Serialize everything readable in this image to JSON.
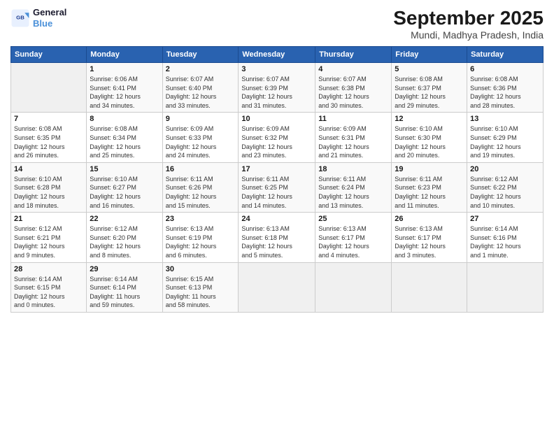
{
  "logo": {
    "line1": "General",
    "line2": "Blue"
  },
  "title": "September 2025",
  "subtitle": "Mundi, Madhya Pradesh, India",
  "days_header": [
    "Sunday",
    "Monday",
    "Tuesday",
    "Wednesday",
    "Thursday",
    "Friday",
    "Saturday"
  ],
  "weeks": [
    [
      {
        "num": "",
        "info": ""
      },
      {
        "num": "1",
        "info": "Sunrise: 6:06 AM\nSunset: 6:41 PM\nDaylight: 12 hours\nand 34 minutes."
      },
      {
        "num": "2",
        "info": "Sunrise: 6:07 AM\nSunset: 6:40 PM\nDaylight: 12 hours\nand 33 minutes."
      },
      {
        "num": "3",
        "info": "Sunrise: 6:07 AM\nSunset: 6:39 PM\nDaylight: 12 hours\nand 31 minutes."
      },
      {
        "num": "4",
        "info": "Sunrise: 6:07 AM\nSunset: 6:38 PM\nDaylight: 12 hours\nand 30 minutes."
      },
      {
        "num": "5",
        "info": "Sunrise: 6:08 AM\nSunset: 6:37 PM\nDaylight: 12 hours\nand 29 minutes."
      },
      {
        "num": "6",
        "info": "Sunrise: 6:08 AM\nSunset: 6:36 PM\nDaylight: 12 hours\nand 28 minutes."
      }
    ],
    [
      {
        "num": "7",
        "info": "Sunrise: 6:08 AM\nSunset: 6:35 PM\nDaylight: 12 hours\nand 26 minutes."
      },
      {
        "num": "8",
        "info": "Sunrise: 6:08 AM\nSunset: 6:34 PM\nDaylight: 12 hours\nand 25 minutes."
      },
      {
        "num": "9",
        "info": "Sunrise: 6:09 AM\nSunset: 6:33 PM\nDaylight: 12 hours\nand 24 minutes."
      },
      {
        "num": "10",
        "info": "Sunrise: 6:09 AM\nSunset: 6:32 PM\nDaylight: 12 hours\nand 23 minutes."
      },
      {
        "num": "11",
        "info": "Sunrise: 6:09 AM\nSunset: 6:31 PM\nDaylight: 12 hours\nand 21 minutes."
      },
      {
        "num": "12",
        "info": "Sunrise: 6:10 AM\nSunset: 6:30 PM\nDaylight: 12 hours\nand 20 minutes."
      },
      {
        "num": "13",
        "info": "Sunrise: 6:10 AM\nSunset: 6:29 PM\nDaylight: 12 hours\nand 19 minutes."
      }
    ],
    [
      {
        "num": "14",
        "info": "Sunrise: 6:10 AM\nSunset: 6:28 PM\nDaylight: 12 hours\nand 18 minutes."
      },
      {
        "num": "15",
        "info": "Sunrise: 6:10 AM\nSunset: 6:27 PM\nDaylight: 12 hours\nand 16 minutes."
      },
      {
        "num": "16",
        "info": "Sunrise: 6:11 AM\nSunset: 6:26 PM\nDaylight: 12 hours\nand 15 minutes."
      },
      {
        "num": "17",
        "info": "Sunrise: 6:11 AM\nSunset: 6:25 PM\nDaylight: 12 hours\nand 14 minutes."
      },
      {
        "num": "18",
        "info": "Sunrise: 6:11 AM\nSunset: 6:24 PM\nDaylight: 12 hours\nand 13 minutes."
      },
      {
        "num": "19",
        "info": "Sunrise: 6:11 AM\nSunset: 6:23 PM\nDaylight: 12 hours\nand 11 minutes."
      },
      {
        "num": "20",
        "info": "Sunrise: 6:12 AM\nSunset: 6:22 PM\nDaylight: 12 hours\nand 10 minutes."
      }
    ],
    [
      {
        "num": "21",
        "info": "Sunrise: 6:12 AM\nSunset: 6:21 PM\nDaylight: 12 hours\nand 9 minutes."
      },
      {
        "num": "22",
        "info": "Sunrise: 6:12 AM\nSunset: 6:20 PM\nDaylight: 12 hours\nand 8 minutes."
      },
      {
        "num": "23",
        "info": "Sunrise: 6:13 AM\nSunset: 6:19 PM\nDaylight: 12 hours\nand 6 minutes."
      },
      {
        "num": "24",
        "info": "Sunrise: 6:13 AM\nSunset: 6:18 PM\nDaylight: 12 hours\nand 5 minutes."
      },
      {
        "num": "25",
        "info": "Sunrise: 6:13 AM\nSunset: 6:17 PM\nDaylight: 12 hours\nand 4 minutes."
      },
      {
        "num": "26",
        "info": "Sunrise: 6:13 AM\nSunset: 6:17 PM\nDaylight: 12 hours\nand 3 minutes."
      },
      {
        "num": "27",
        "info": "Sunrise: 6:14 AM\nSunset: 6:16 PM\nDaylight: 12 hours\nand 1 minute."
      }
    ],
    [
      {
        "num": "28",
        "info": "Sunrise: 6:14 AM\nSunset: 6:15 PM\nDaylight: 12 hours\nand 0 minutes."
      },
      {
        "num": "29",
        "info": "Sunrise: 6:14 AM\nSunset: 6:14 PM\nDaylight: 11 hours\nand 59 minutes."
      },
      {
        "num": "30",
        "info": "Sunrise: 6:15 AM\nSunset: 6:13 PM\nDaylight: 11 hours\nand 58 minutes."
      },
      {
        "num": "",
        "info": ""
      },
      {
        "num": "",
        "info": ""
      },
      {
        "num": "",
        "info": ""
      },
      {
        "num": "",
        "info": ""
      }
    ]
  ]
}
